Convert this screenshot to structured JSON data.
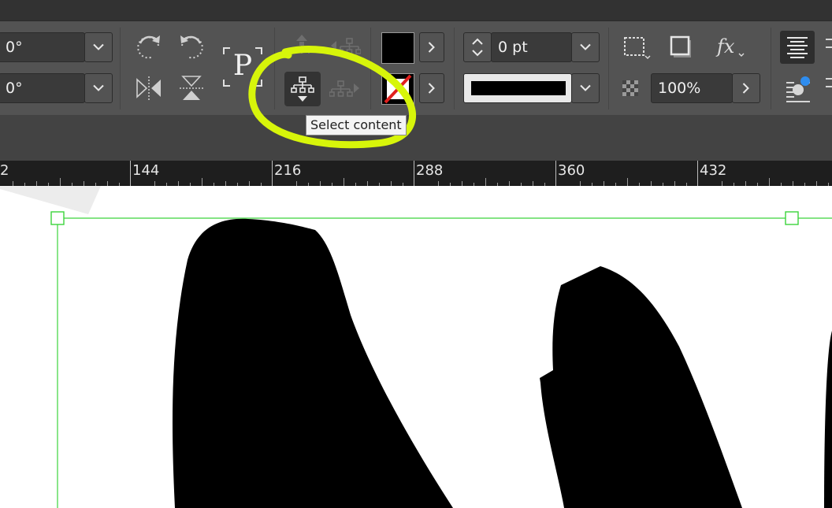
{
  "control_panel": {
    "rotation_angle": "0°",
    "shear_angle": "0°",
    "stroke_weight": "0 pt",
    "opacity": "100%",
    "selected_tool_tooltip": "Select content",
    "placeholder_glyph": "P",
    "fx_label": "fx"
  },
  "colors": {
    "panel_bg": "#535353",
    "fill_swatch": "#000000",
    "highlight_annotation": "#d7f50a",
    "frame_selection": "#3bd43b"
  },
  "ruler": {
    "labels": [
      "2",
      "144",
      "216",
      "288",
      "360",
      "432"
    ]
  },
  "icons": [
    "rotate-clockwise-icon",
    "rotate-counterclockwise-icon",
    "flip-horizontal-icon",
    "flip-vertical-icon",
    "text-frame-placeholder-icon",
    "select-container-icon",
    "select-content-icon",
    "select-previous-object-icon",
    "select-next-object-icon",
    "fill-swatch-icon",
    "stroke-swatch-icon",
    "stroke-type-icon",
    "frame-fitting-icon",
    "drop-shadow-icon",
    "effects-icon",
    "opacity-icon",
    "align-icon",
    "wrap-icon"
  ]
}
